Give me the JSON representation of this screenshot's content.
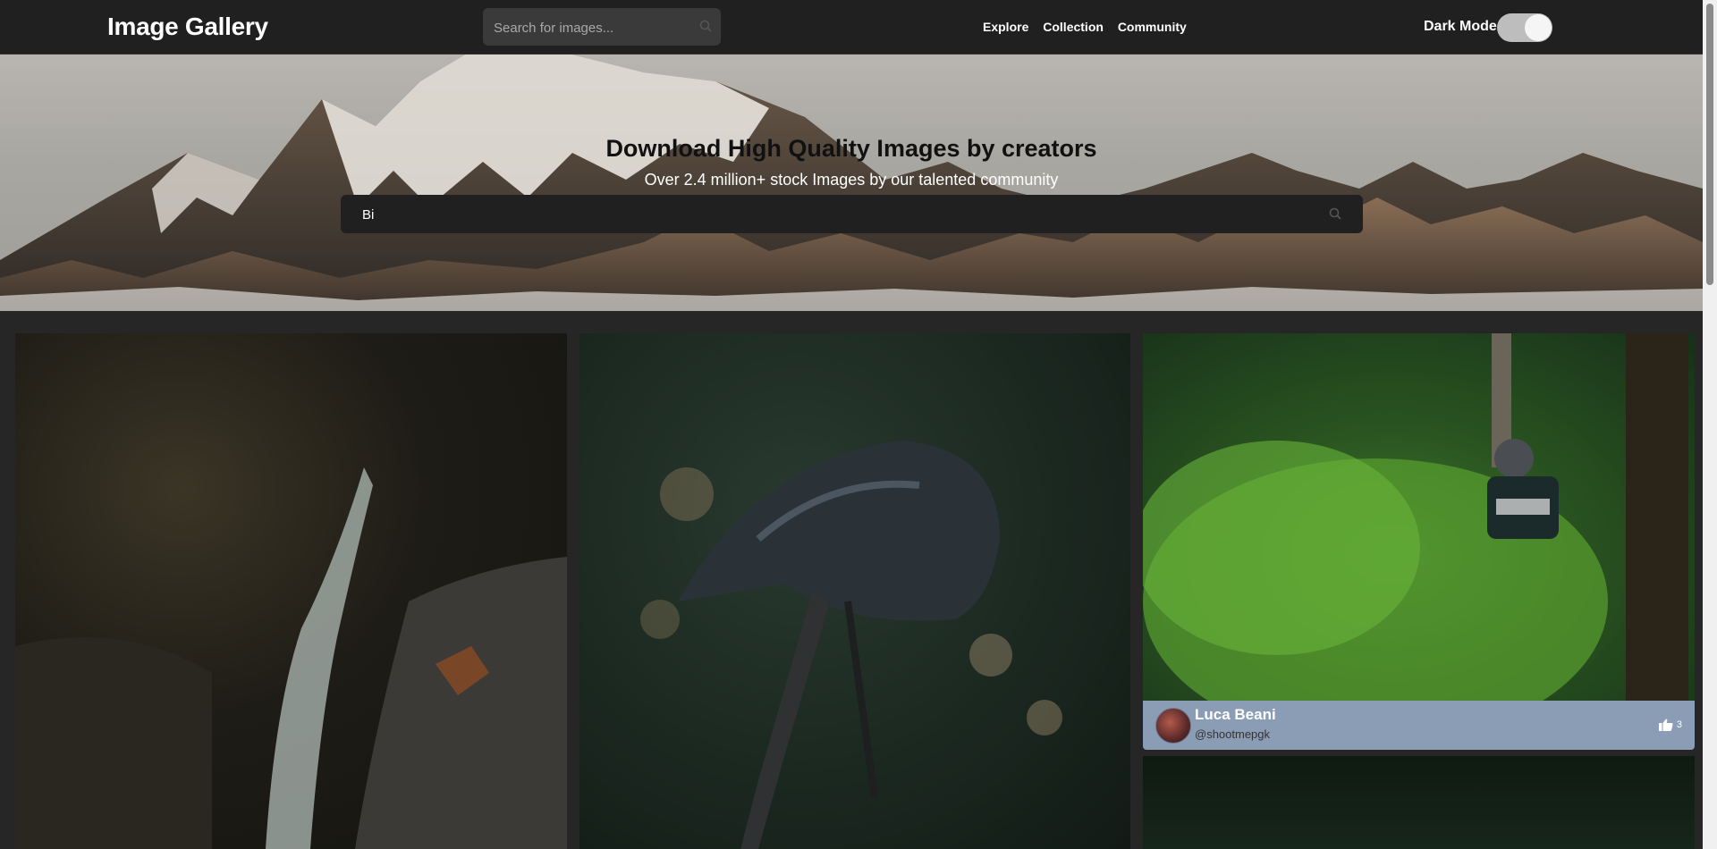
{
  "header": {
    "brand": "Image Gallery",
    "search_placeholder": "Search for images...",
    "nav": [
      "Explore",
      "Collection",
      "Community"
    ],
    "dark_mode_label": "Dark Mode",
    "dark_mode_on": true
  },
  "hero": {
    "title": "Download High Quality Images by creators",
    "subtitle": "Over 2.4 million+ stock Images by our talented community",
    "search_value": "Bi"
  },
  "cards": [
    {
      "image": "waterfall-photo"
    },
    {
      "image": "bike-helmet-photo"
    },
    {
      "image": "forest-rider-photo",
      "author": "Luca Beani",
      "handle": "@shootmepgk",
      "likes": "3"
    },
    {
      "image": "forest-photo"
    }
  ],
  "colors": {
    "header_bg": "#202020",
    "page_bg": "#262626",
    "credit_bar": "#8b9cb5"
  }
}
